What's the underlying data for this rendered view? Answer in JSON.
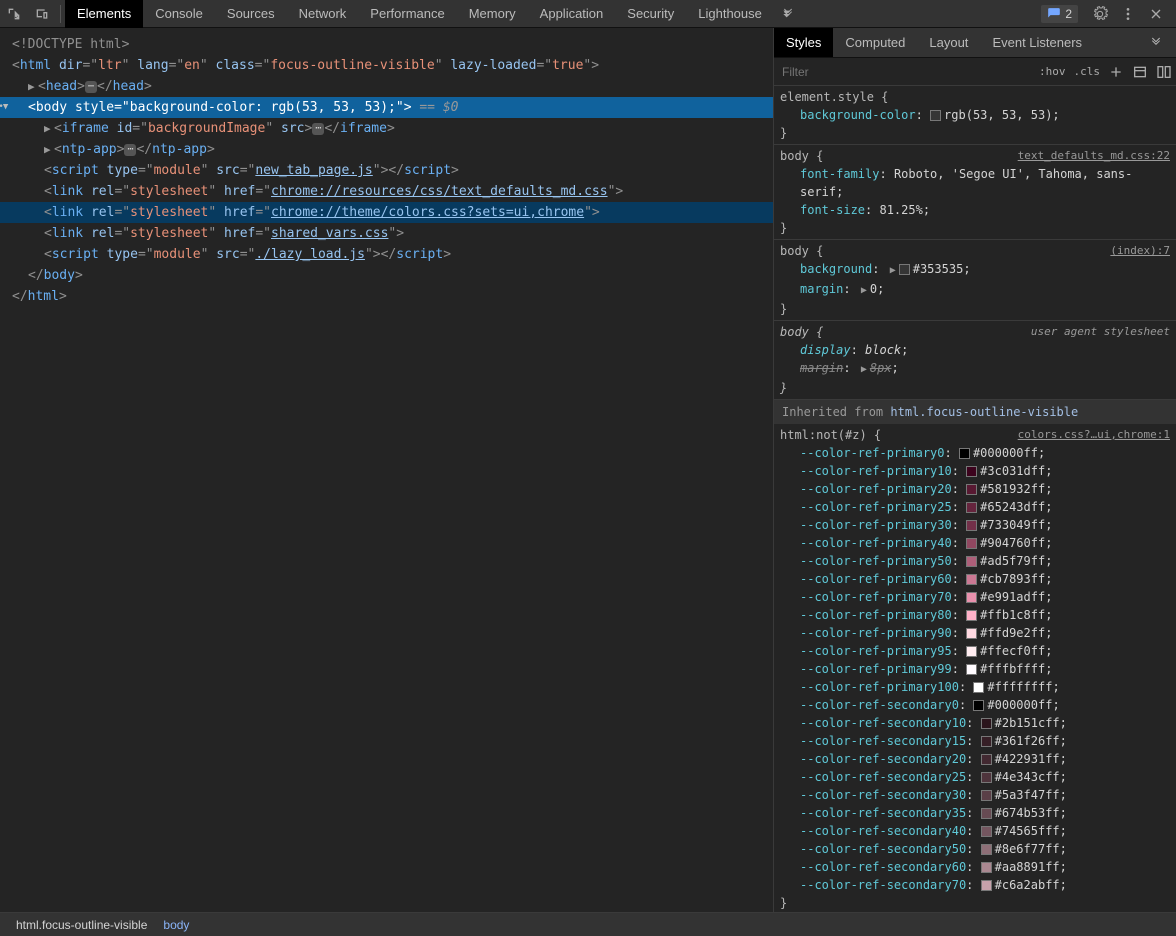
{
  "toolbar": {
    "tabs": [
      "Elements",
      "Console",
      "Sources",
      "Network",
      "Performance",
      "Memory",
      "Application",
      "Security",
      "Lighthouse"
    ],
    "issue_count": "2"
  },
  "dom": {
    "doctype": "<!DOCTYPE html>",
    "html_attrs": {
      "dir": "ltr",
      "lang": "en",
      "class": "focus-outline-visible",
      "lazy": "true"
    },
    "body_style": "background-color: rgb(53, 53, 53);",
    "body_eq": "== $0",
    "iframe": {
      "id": "backgroundImage",
      "src": "…"
    },
    "ntp": "ntp-app",
    "script1_src": "new_tab_page.js",
    "link1_href": "chrome://resources/css/text_defaults_md.css",
    "link2_href": "chrome://theme/colors.css?sets=ui,chrome",
    "link3_href": "shared_vars.css",
    "script2_src": "./lazy_load.js"
  },
  "sidebar": {
    "tabs": [
      "Styles",
      "Computed",
      "Layout",
      "Event Listeners"
    ],
    "filter_placeholder": "Filter",
    "hov_label": ":hov",
    "cls_label": ".cls"
  },
  "rules": {
    "element_style": {
      "selector": "element.style",
      "props": [
        {
          "name": "background-color",
          "value": "rgb(53, 53, 53)",
          "color": "#353535"
        }
      ]
    },
    "body_md": {
      "selector": "body",
      "origin": "text_defaults_md.css:22",
      "props": [
        {
          "name": "font-family",
          "value": "Roboto, 'Segoe UI', Tahoma, sans-serif"
        },
        {
          "name": "font-size",
          "value": "81.25%"
        }
      ]
    },
    "body_idx": {
      "selector": "body",
      "origin": "(index):7",
      "props": [
        {
          "name": "background",
          "value": "#353535",
          "color": "#353535",
          "expand": true
        },
        {
          "name": "margin",
          "value": "0",
          "expand": true
        }
      ]
    },
    "body_ua": {
      "selector": "body",
      "origin": "user agent stylesheet",
      "props": [
        {
          "name": "display",
          "value": "block"
        },
        {
          "name": "margin",
          "value": "8px",
          "expand": true,
          "struck": true
        }
      ]
    },
    "inherited_label": "Inherited from",
    "inherited_from": "html.focus-outline-visible",
    "html_rule": {
      "selector": "html:not(#z)",
      "origin": "colors.css?…ui,chrome:1",
      "props": [
        {
          "name": "--color-ref-primary0",
          "value": "#000000ff",
          "color": "#000000"
        },
        {
          "name": "--color-ref-primary10",
          "value": "#3c031dff",
          "color": "#3c031d"
        },
        {
          "name": "--color-ref-primary20",
          "value": "#581932ff",
          "color": "#581932"
        },
        {
          "name": "--color-ref-primary25",
          "value": "#65243dff",
          "color": "#65243d"
        },
        {
          "name": "--color-ref-primary30",
          "value": "#733049ff",
          "color": "#733049"
        },
        {
          "name": "--color-ref-primary40",
          "value": "#904760ff",
          "color": "#904760"
        },
        {
          "name": "--color-ref-primary50",
          "value": "#ad5f79ff",
          "color": "#ad5f79"
        },
        {
          "name": "--color-ref-primary60",
          "value": "#cb7893ff",
          "color": "#cb7893"
        },
        {
          "name": "--color-ref-primary70",
          "value": "#e991adff",
          "color": "#e991ad"
        },
        {
          "name": "--color-ref-primary80",
          "value": "#ffb1c8ff",
          "color": "#ffb1c8"
        },
        {
          "name": "--color-ref-primary90",
          "value": "#ffd9e2ff",
          "color": "#ffd9e2"
        },
        {
          "name": "--color-ref-primary95",
          "value": "#ffecf0ff",
          "color": "#ffecf0"
        },
        {
          "name": "--color-ref-primary99",
          "value": "#fffbffff",
          "color": "#fffbff"
        },
        {
          "name": "--color-ref-primary100",
          "value": "#ffffffff",
          "color": "#ffffff"
        },
        {
          "name": "--color-ref-secondary0",
          "value": "#000000ff",
          "color": "#000000"
        },
        {
          "name": "--color-ref-secondary10",
          "value": "#2b151cff",
          "color": "#2b151c"
        },
        {
          "name": "--color-ref-secondary15",
          "value": "#361f26ff",
          "color": "#361f26"
        },
        {
          "name": "--color-ref-secondary20",
          "value": "#422931ff",
          "color": "#422931"
        },
        {
          "name": "--color-ref-secondary25",
          "value": "#4e343cff",
          "color": "#4e343c"
        },
        {
          "name": "--color-ref-secondary30",
          "value": "#5a3f47ff",
          "color": "#5a3f47"
        },
        {
          "name": "--color-ref-secondary35",
          "value": "#674b53ff",
          "color": "#674b53"
        },
        {
          "name": "--color-ref-secondary40",
          "value": "#74565fff",
          "color": "#74565f"
        },
        {
          "name": "--color-ref-secondary50",
          "value": "#8e6f77ff",
          "color": "#8e6f77"
        },
        {
          "name": "--color-ref-secondary60",
          "value": "#aa8891ff",
          "color": "#aa8891"
        },
        {
          "name": "--color-ref-secondary70",
          "value": "#c6a2abff",
          "color": "#c6a2ab"
        }
      ]
    }
  },
  "breadcrumb": {
    "items": [
      "html.focus-outline-visible",
      "body"
    ]
  }
}
